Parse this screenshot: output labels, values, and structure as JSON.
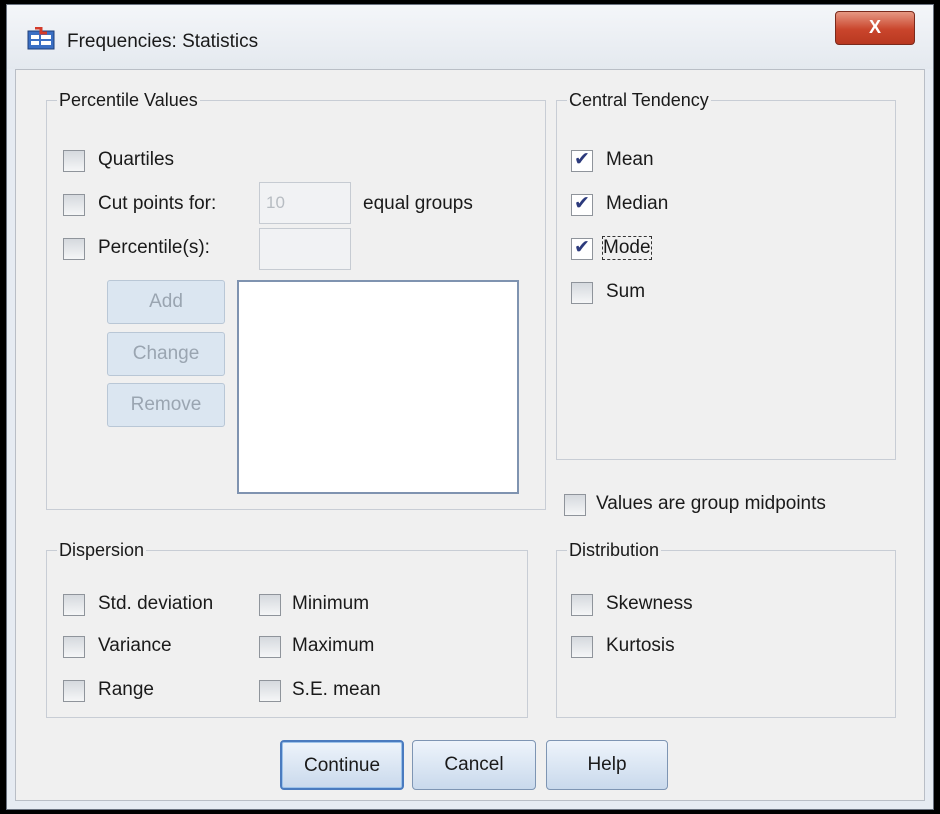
{
  "window": {
    "title": "Frequencies: Statistics",
    "close_label": "X"
  },
  "percentile_values": {
    "legend": "Percentile Values",
    "quartiles": {
      "label": "Quartiles",
      "checked": false
    },
    "cut_points": {
      "label": "Cut points for:",
      "value": "10",
      "suffix": "equal groups",
      "checked": false
    },
    "percentiles": {
      "label": "Percentile(s):",
      "value": "",
      "checked": false
    },
    "buttons": {
      "add": "Add",
      "change": "Change",
      "remove": "Remove"
    }
  },
  "central_tendency": {
    "legend": "Central Tendency",
    "items": [
      {
        "label": "Mean",
        "checked": true
      },
      {
        "label": "Median",
        "checked": true
      },
      {
        "label": "Mode",
        "checked": true
      },
      {
        "label": "Sum",
        "checked": false
      }
    ]
  },
  "group_midpoints": {
    "label": "Values are group midpoints",
    "checked": false
  },
  "dispersion": {
    "legend": "Dispersion",
    "items": [
      {
        "label": "Std. deviation",
        "checked": false
      },
      {
        "label": "Minimum",
        "checked": false
      },
      {
        "label": "Variance",
        "checked": false
      },
      {
        "label": "Maximum",
        "checked": false
      },
      {
        "label": "Range",
        "checked": false
      },
      {
        "label": "S.E. mean",
        "checked": false
      }
    ]
  },
  "distribution": {
    "legend": "Distribution",
    "items": [
      {
        "label": "Skewness",
        "checked": false
      },
      {
        "label": "Kurtosis",
        "checked": false
      }
    ]
  },
  "footer": {
    "continue": "Continue",
    "cancel": "Cancel",
    "help": "Help"
  },
  "colors": {
    "close_button": "#c9452c",
    "check_mark": "#2c3a7c",
    "default_button_border": "#4a7bbf"
  }
}
